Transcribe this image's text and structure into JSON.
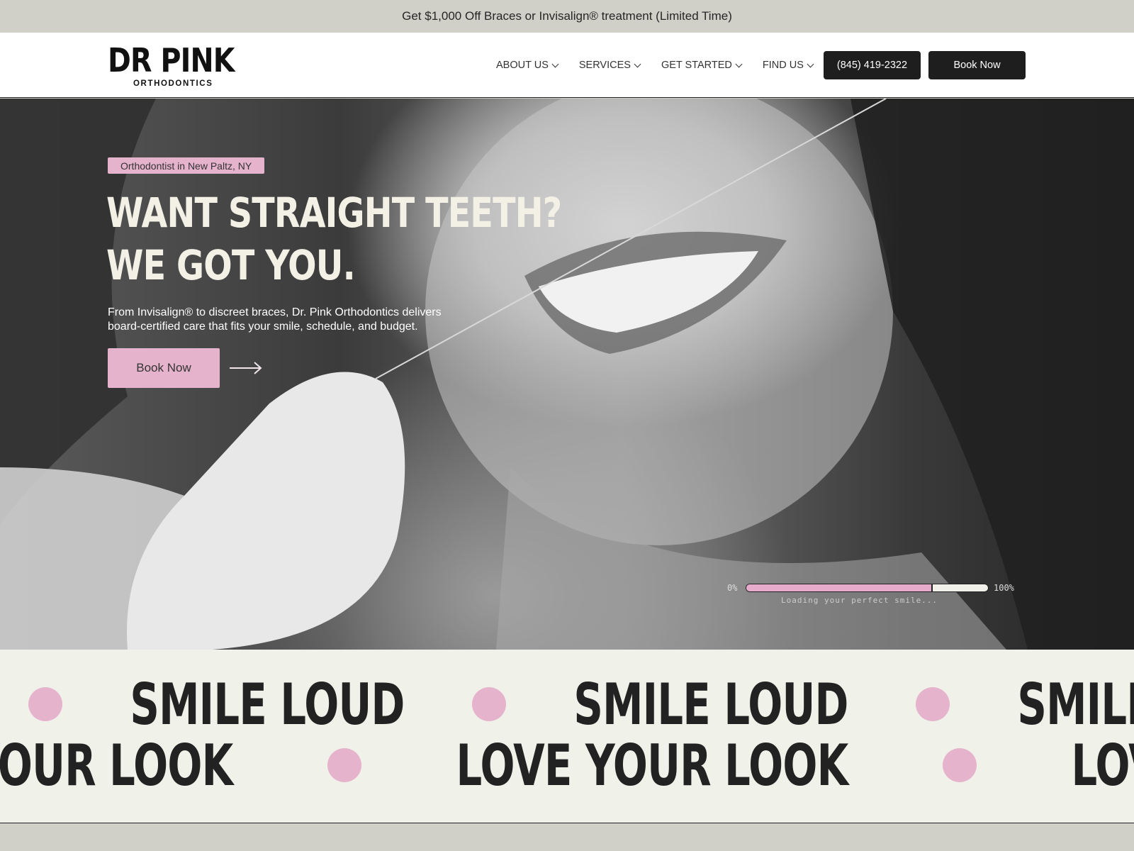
{
  "promo": {
    "text": "Get $1,000 Off Braces or Invisalign® treatment (Limited Time)"
  },
  "header": {
    "logo_main": "DR PINK",
    "logo_sub": "ORTHODONTICS",
    "nav": [
      {
        "label": "ABOUT US"
      },
      {
        "label": "SERVICES"
      },
      {
        "label": "GET STARTED"
      },
      {
        "label": "FIND US"
      }
    ],
    "phone": "(845) 419-2322",
    "book_label": "Book Now"
  },
  "hero": {
    "tag": "Orthodontist in New Paltz, NY",
    "title_line1": "WANT STRAIGHT TEETH?",
    "title_line2": "WE GOT YOU.",
    "description": "From Invisalign® to discreet braces, Dr. Pink Orthodontics delivers board-certified care that fits your smile, schedule, and budget.",
    "cta": "Book Now",
    "progress": {
      "min_label": "0%",
      "max_label": "100%",
      "value_percent": 77,
      "label": "Loading your perfect smile..."
    }
  },
  "marquee": {
    "row1": "SMILE LOUD",
    "row2": "LOVE YOUR LOOK"
  },
  "colors": {
    "pink": "#e6b3cc",
    "dark": "#1e1e1e",
    "cream": "#f0f2ea"
  },
  "icons": {
    "nav_dropdown": "chevron-down-icon",
    "cta_arrow": "arrow-right-icon"
  }
}
